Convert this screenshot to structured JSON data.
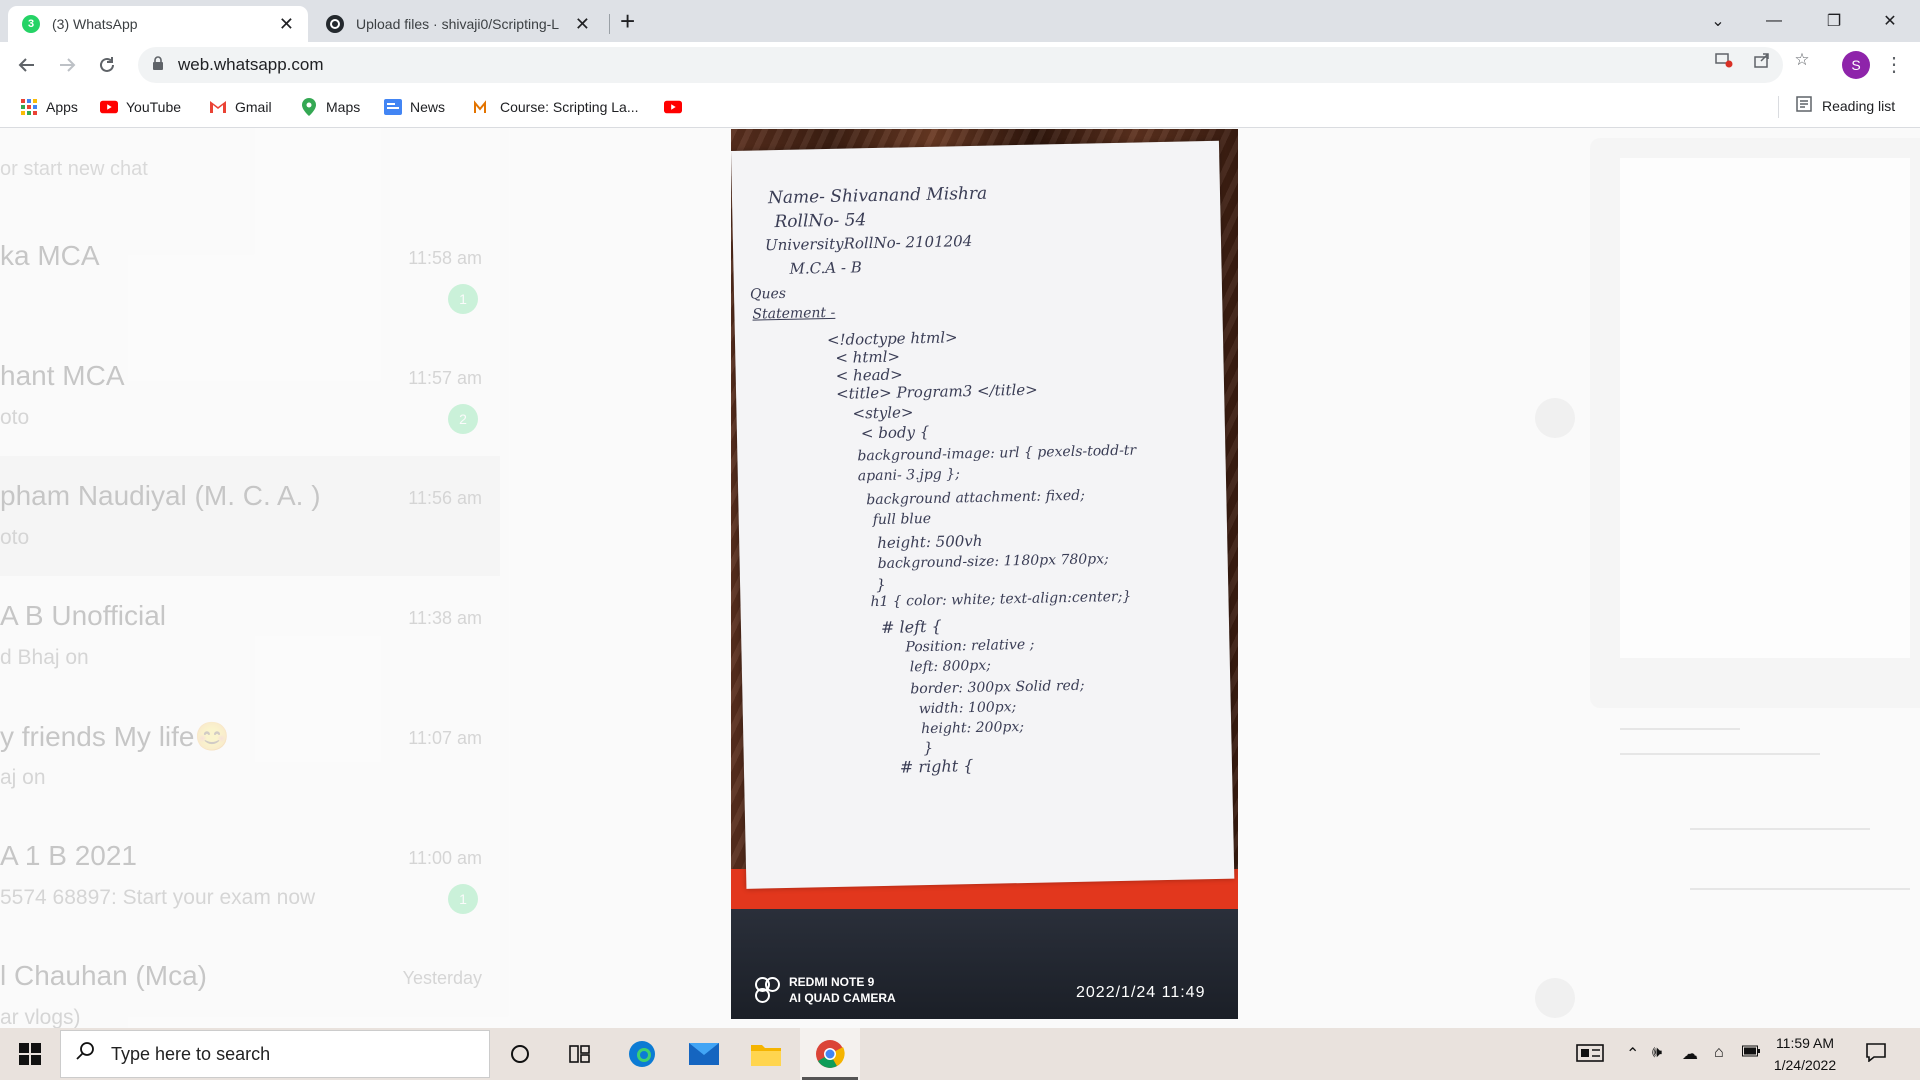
{
  "browser": {
    "tabs": [
      {
        "title": "(3) WhatsApp",
        "badge": "3",
        "active": true,
        "close": "✕"
      },
      {
        "title": "Upload files · shivaji0/Scripting-L",
        "active": false,
        "close": "✕"
      }
    ],
    "new_tab": "+",
    "window_controls": {
      "dropdown": "⌄",
      "minimize": "—",
      "restore": "❐",
      "close": "✕"
    },
    "url": "web.whatsapp.com",
    "profile_initial": "S",
    "bookmarks": [
      {
        "label": "Apps",
        "icon": "apps-grid-icon"
      },
      {
        "label": "YouTube",
        "icon": "youtube-icon"
      },
      {
        "label": "Gmail",
        "icon": "gmail-icon"
      },
      {
        "label": "Maps",
        "icon": "maps-icon"
      },
      {
        "label": "News",
        "icon": "news-icon"
      },
      {
        "label": "Course: Scripting La...",
        "icon": "course-icon"
      }
    ],
    "reading_list": "Reading list"
  },
  "whatsapp": {
    "search_hint": "or start new chat",
    "chats": [
      {
        "name": "ka MCA",
        "time": "11:58 am",
        "message": "",
        "badge": "1"
      },
      {
        "name": "hant MCA",
        "time": "11:57 am",
        "message": "oto",
        "badge": "2"
      },
      {
        "name": "pham Naudiyal (M. C. A. )",
        "time": "11:56 am",
        "message": "oto",
        "badge": ""
      },
      {
        "name": "A B  Unofficial",
        "time": "11:38 am",
        "message": "d Bhaj on",
        "badge": ""
      },
      {
        "name": "y friends My life😊",
        "time": "11:07 am",
        "message": "aj on",
        "badge": ""
      },
      {
        "name": "A 1 B  2021",
        "time": "11:00 am",
        "message": "5574 68897: Start your exam now",
        "badge": "1"
      },
      {
        "name": "l Chauhan (Mca)",
        "time": "Yesterday",
        "message": "ar vlogs)",
        "badge": ""
      }
    ]
  },
  "photo": {
    "handwriting": [
      "Name- Shivanand Mishra",
      "RollNo- 54",
      "UniversityRollNo- 2101204",
      "M.C.A - B",
      "Ques",
      "Statement -",
      "<!doctype html>",
      "< html>",
      "< head>",
      "<title> Program3 </title>",
      "<style>",
      "< body {",
      "background-image: url { pexels-todd-tr",
      "apani- 3.jpg };",
      "background attachment: fixed;",
      "full blue",
      "height: 500vh",
      "background-size: 1180px 780px;",
      "}",
      "h1 { color: white; text-align:center;}",
      "# left {",
      "Position: relative ;",
      "left: 800px;",
      "border: 300px Solid red;",
      "width: 100px;",
      "height: 200px;",
      "}",
      "# right {"
    ],
    "camera_model": "REDMI NOTE 9",
    "camera_tagline": "AI QUAD CAMERA",
    "timestamp": "2022/1/24 11:49"
  },
  "taskbar": {
    "search_placeholder": "Type here to search",
    "time": "11:59 AM",
    "date": "1/24/2022"
  },
  "colors": {
    "whatsapp_green": "#25d366",
    "tab_strip": "#dee1e6",
    "paper_red": "#e2371d",
    "profile_purple": "#8e24aa"
  }
}
